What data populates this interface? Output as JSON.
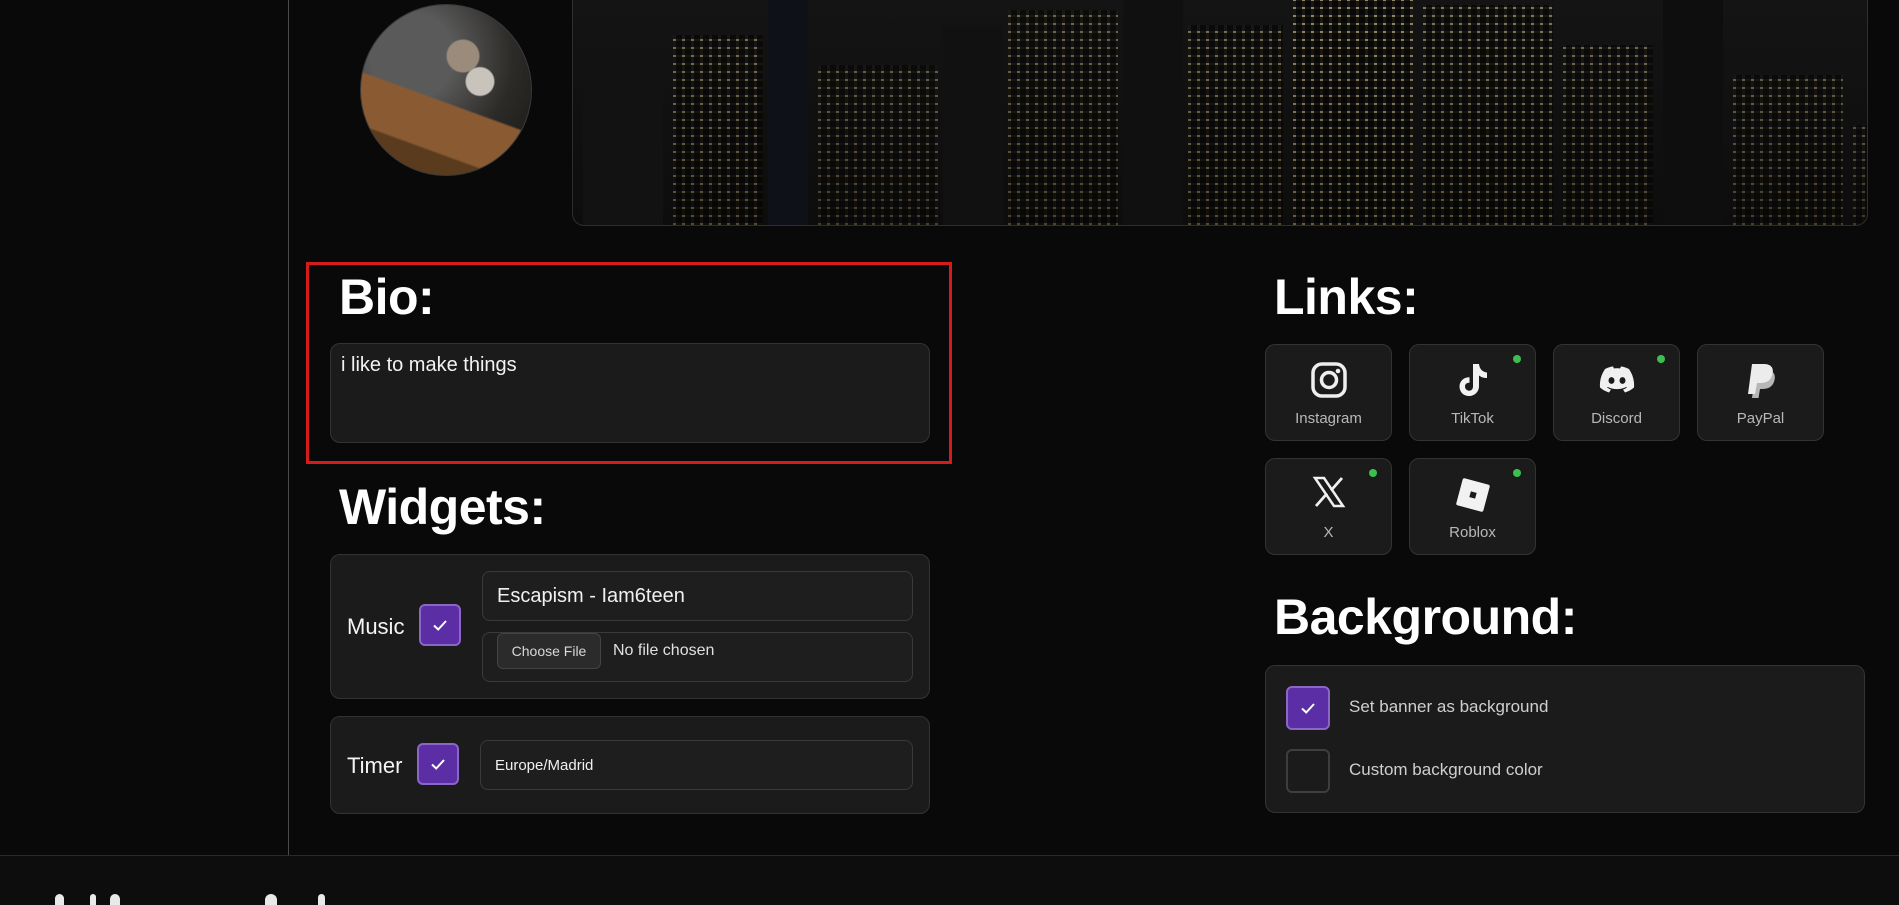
{
  "bio": {
    "title": "Bio:",
    "text": "i like to make things"
  },
  "widgets": {
    "title": "Widgets:",
    "music": {
      "label": "Music",
      "enabled": true,
      "song": "Escapism - Iam6teen",
      "file_button": "Choose File",
      "file_status": "No file chosen"
    },
    "timer": {
      "label": "Timer",
      "enabled": true,
      "timezone": "Europe/Madrid"
    }
  },
  "links": {
    "title": "Links:",
    "items": [
      {
        "label": "Instagram",
        "icon": "instagram-icon",
        "active": false
      },
      {
        "label": "TikTok",
        "icon": "tiktok-icon",
        "active": true
      },
      {
        "label": "Discord",
        "icon": "discord-icon",
        "active": true
      },
      {
        "label": "PayPal",
        "icon": "paypal-icon",
        "active": false
      },
      {
        "label": "X",
        "icon": "x-icon",
        "active": true
      },
      {
        "label": "Roblox",
        "icon": "roblox-icon",
        "active": true
      }
    ]
  },
  "background": {
    "title": "Background:",
    "options": [
      {
        "label": "Set banner as background",
        "checked": true
      },
      {
        "label": "Custom background color",
        "checked": false
      }
    ]
  },
  "colors": {
    "accent": "#5b2ea5",
    "status_active": "#3bbf4e",
    "highlight": "#d51b1b"
  }
}
